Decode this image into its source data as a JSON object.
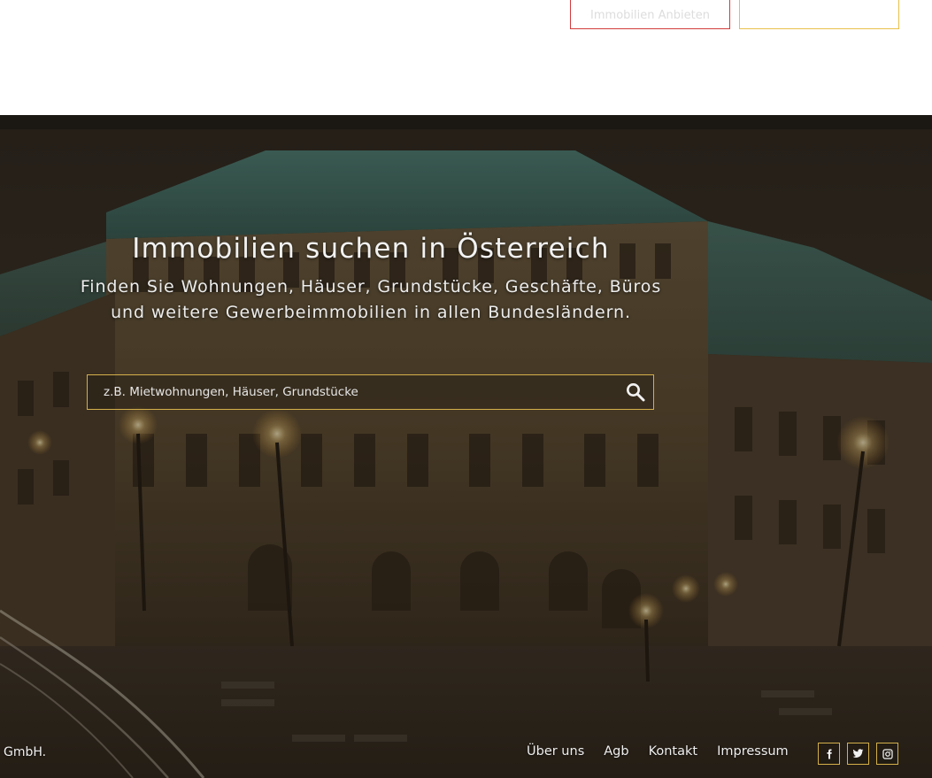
{
  "top_buttons": {
    "left_label": "Immobilien Anbieten",
    "right_label": ""
  },
  "hero": {
    "title": "Immobilien suchen in Österreich",
    "subtitle_line1": "Finden Sie Wohnungen, Häuser, Grundstücke, Geschäfte, Büros",
    "subtitle_line2": "und weitere Gewerbeimmobilien in allen Bundesländern.",
    "search": {
      "placeholder": "z.B. Mietwohnungen, Häuser, Grundstücke",
      "value": "",
      "icon": "search-icon"
    }
  },
  "footer": {
    "copyright": "GmbH.",
    "links": [
      "Über uns",
      "Agb",
      "Kontakt",
      "Impressum"
    ],
    "socials": [
      "facebook-icon",
      "twitter-icon",
      "instagram-icon"
    ]
  },
  "colors": {
    "accent_gold": "#d4b04a",
    "accent_red": "#d23b3b",
    "text_light": "#f2f2f2"
  }
}
